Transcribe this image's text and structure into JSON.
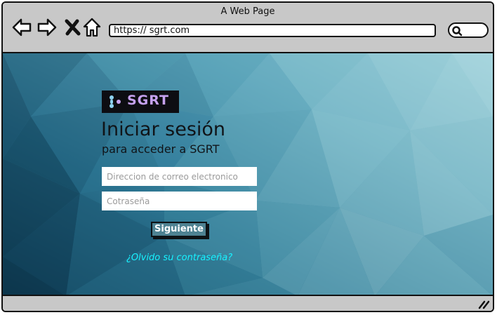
{
  "browser": {
    "title": "A Web Page",
    "url": "https:// sgrt.com",
    "icons": [
      "back-arrow-icon",
      "forward-arrow-icon",
      "close-icon",
      "home-icon",
      "search-icon"
    ]
  },
  "login": {
    "logo_text": "SGRT",
    "heading": "Iniciar sesión",
    "subheading": "para acceder a SGRT",
    "email_placeholder": "Direccion de correo electronico",
    "password_placeholder": "Cotraseña",
    "submit_label": "Siguiente",
    "forgot_link": "¿Olvido su contraseña?"
  },
  "colors": {
    "link": "#17f2ff",
    "button": "#4e8292",
    "background_dark": "#1a4d66",
    "background_light": "#8fc6d1"
  }
}
